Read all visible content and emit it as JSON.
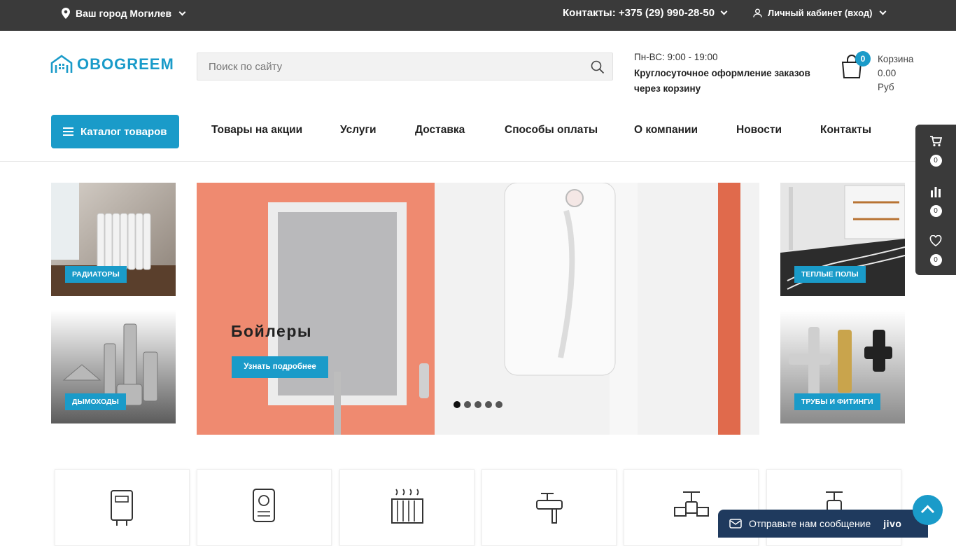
{
  "topbar": {
    "city_label": "Ваш город Могилев",
    "contacts_label": "Контакты: +375 (29) 990-28-50",
    "account_label": "Личный кабинет (вход)"
  },
  "header": {
    "logo_text": "OBOGREEM",
    "search_placeholder": "Поиск по сайту",
    "hours": "Пн-ВС: 9:00 - 19:00",
    "orders_note": "Круглосуточное оформление заказов через корзину",
    "cart": {
      "count": "0",
      "label": "Корзина",
      "amount": "0.00",
      "currency": "Руб"
    }
  },
  "nav": {
    "catalog_button": "Каталог товаров",
    "items": [
      "Товары на акции",
      "Услуги",
      "Доставка",
      "Способы оплаты",
      "О компании",
      "Новости",
      "Контакты"
    ]
  },
  "side_widget": {
    "cart_count": "0",
    "compare_count": "0",
    "favorites_count": "0"
  },
  "tiles": {
    "radiators": "РАДИАТОРЫ",
    "chimneys": "ДЫМОХОДЫ",
    "warm_floors": "ТЕПЛЫЕ ПОЛЫ",
    "pipes": "ТРУБЫ И ФИТИНГИ"
  },
  "slider": {
    "title": "Бойлеры",
    "button": "Узнать подробнее",
    "dots": 5,
    "active_dot": 0
  },
  "chat": {
    "label": "Отправьте нам сообщение",
    "brand": "jivo"
  },
  "colors": {
    "accent": "#1a9bc9",
    "topbar": "#3a3a3a",
    "chat": "#1f3a5e"
  }
}
